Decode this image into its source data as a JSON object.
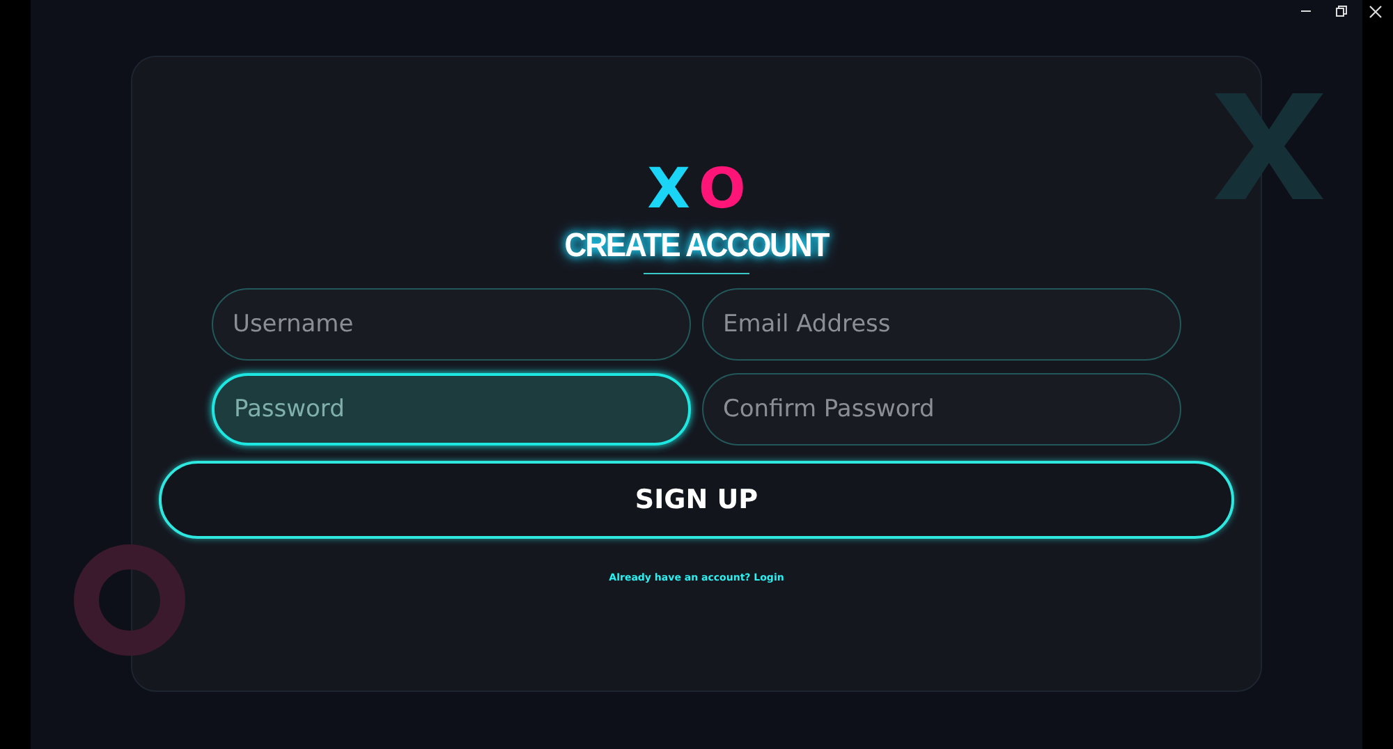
{
  "window_controls": [
    {
      "kind": "minimize"
    },
    {
      "kind": "restore"
    },
    {
      "kind": "close"
    }
  ],
  "logo": {
    "x": "X",
    "o": "O"
  },
  "title": "CREATE ACCOUNT",
  "fields": [
    {
      "placeholder": "Username",
      "focused": false
    },
    {
      "placeholder": "Email Address",
      "focused": false
    },
    {
      "placeholder": "Password",
      "focused": true
    },
    {
      "placeholder": "Confirm Password",
      "focused": false
    }
  ],
  "submit": "SIGN UP",
  "login_link": "Already have an account? Login"
}
